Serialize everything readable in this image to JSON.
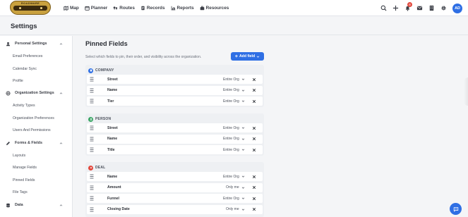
{
  "app": {
    "logo_text": "ROADWARE"
  },
  "nav": {
    "items": [
      {
        "label": "Map",
        "icon": "map-icon"
      },
      {
        "label": "Planner",
        "icon": "calendar-icon"
      },
      {
        "label": "Routes",
        "icon": "routes-icon"
      },
      {
        "label": "Records",
        "icon": "records-icon"
      },
      {
        "label": "Reports",
        "icon": "reports-icon"
      },
      {
        "label": "Resources",
        "icon": "resources-icon"
      }
    ]
  },
  "topbar": {
    "notification_count": "8",
    "avatar_initials": "AD",
    "icons": [
      "search-icon",
      "plus-icon",
      "bell-icon",
      "mail-icon",
      "building-icon",
      "gear-icon"
    ]
  },
  "page": {
    "title": "Settings"
  },
  "sidebar": {
    "sections": [
      {
        "label": "Personal Settings",
        "icon": "user-icon",
        "expanded": true,
        "items": [
          "Email Preferences",
          "Calendar Sync",
          "Profile"
        ]
      },
      {
        "label": "Organization Settings",
        "icon": "globe-icon",
        "expanded": true,
        "items": [
          "Activity Types",
          "Organization Preferences",
          "Users And Permissions"
        ]
      },
      {
        "label": "Forms & Fields",
        "icon": "pencil-icon",
        "expanded": true,
        "items": [
          "Layouts",
          "Manage Fields",
          "Pinned Fields",
          "File Tags"
        ]
      },
      {
        "label": "Data",
        "icon": "database-icon",
        "expanded": true,
        "items": []
      }
    ]
  },
  "main": {
    "title": "Pinned Fields",
    "subtitle": "Select which fields to pin, their order, and visibility across the organization.",
    "add_button_label": "Add field",
    "groups": [
      {
        "label": "COMPANY",
        "color": "#2f6fe4",
        "icon": "company-icon",
        "fields": [
          {
            "name": "Street",
            "visibility": "Entire Org"
          },
          {
            "name": "Name",
            "visibility": "Entire Org"
          },
          {
            "name": "Tier",
            "visibility": "Entire Org"
          }
        ]
      },
      {
        "label": "PERSON",
        "color": "#3aa565",
        "icon": "person-icon",
        "fields": [
          {
            "name": "Street",
            "visibility": "Entire Org"
          },
          {
            "name": "Name",
            "visibility": "Entire Org"
          },
          {
            "name": "Title",
            "visibility": "Entire Org"
          }
        ]
      },
      {
        "label": "DEAL",
        "color": "#e2483d",
        "icon": "deal-icon",
        "fields": [
          {
            "name": "Name",
            "visibility": "Entire Org"
          },
          {
            "name": "Amount",
            "visibility": "Only me"
          },
          {
            "name": "Funnel",
            "visibility": "Entire Org"
          },
          {
            "name": "Closing Date",
            "visibility": "Only me"
          }
        ]
      }
    ]
  }
}
